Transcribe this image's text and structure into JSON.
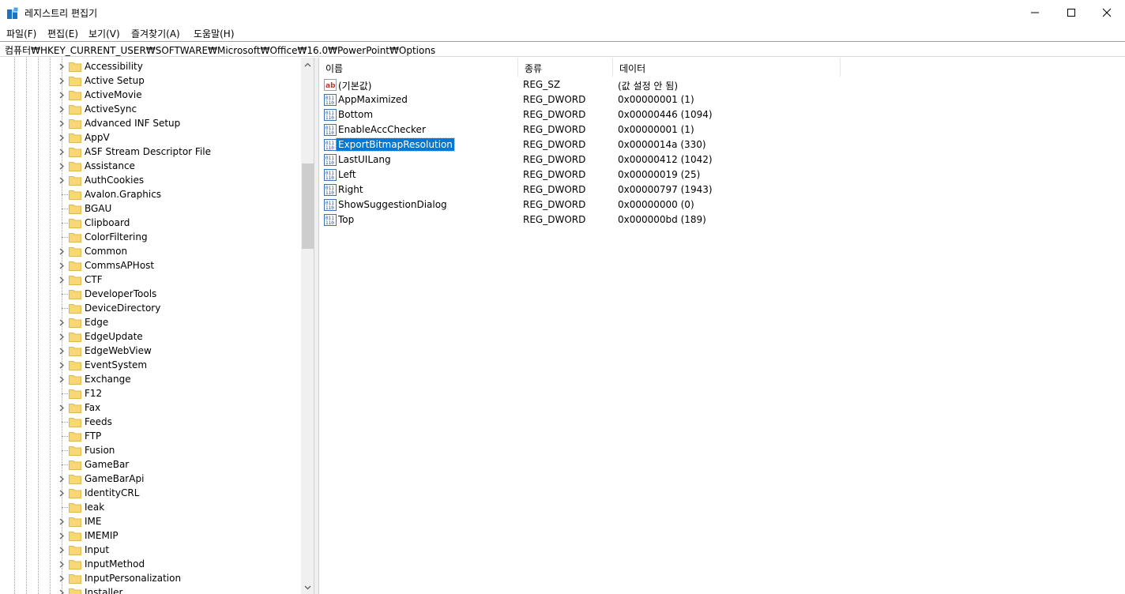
{
  "window": {
    "title": "레지스트리 편집기",
    "minimize_glyph": "—",
    "maximize_glyph": "☐",
    "close_glyph": "✕"
  },
  "menu": [
    "파일(F)",
    "편집(E)",
    "보기(V)",
    "즐겨찾기(A)",
    "도움말(H)"
  ],
  "address": "컴퓨터₩HKEY_CURRENT_USER₩SOFTWARE₩Microsoft₩Office₩16.0₩PowerPoint₩Options",
  "tree": {
    "items": [
      {
        "label": "Accessibility",
        "expandable": true
      },
      {
        "label": "Active Setup",
        "expandable": true
      },
      {
        "label": "ActiveMovie",
        "expandable": true
      },
      {
        "label": "ActiveSync",
        "expandable": true
      },
      {
        "label": "Advanced INF Setup",
        "expandable": true
      },
      {
        "label": "AppV",
        "expandable": true
      },
      {
        "label": "ASF Stream Descriptor File",
        "expandable": true
      },
      {
        "label": "Assistance",
        "expandable": true
      },
      {
        "label": "AuthCookies",
        "expandable": true
      },
      {
        "label": "Avalon.Graphics",
        "expandable": false
      },
      {
        "label": "BGAU",
        "expandable": false
      },
      {
        "label": "Clipboard",
        "expandable": false
      },
      {
        "label": "ColorFiltering",
        "expandable": false
      },
      {
        "label": "Common",
        "expandable": true
      },
      {
        "label": "CommsAPHost",
        "expandable": true
      },
      {
        "label": "CTF",
        "expandable": true
      },
      {
        "label": "DeveloperTools",
        "expandable": false
      },
      {
        "label": "DeviceDirectory",
        "expandable": false
      },
      {
        "label": "Edge",
        "expandable": true
      },
      {
        "label": "EdgeUpdate",
        "expandable": true
      },
      {
        "label": "EdgeWebView",
        "expandable": true
      },
      {
        "label": "EventSystem",
        "expandable": true
      },
      {
        "label": "Exchange",
        "expandable": true
      },
      {
        "label": "F12",
        "expandable": false
      },
      {
        "label": "Fax",
        "expandable": true
      },
      {
        "label": "Feeds",
        "expandable": false
      },
      {
        "label": "FTP",
        "expandable": false
      },
      {
        "label": "Fusion",
        "expandable": false
      },
      {
        "label": "GameBar",
        "expandable": false
      },
      {
        "label": "GameBarApi",
        "expandable": true
      },
      {
        "label": "IdentityCRL",
        "expandable": true
      },
      {
        "label": "Ieak",
        "expandable": false
      },
      {
        "label": "IME",
        "expandable": true
      },
      {
        "label": "IMEMIP",
        "expandable": true
      },
      {
        "label": "Input",
        "expandable": true
      },
      {
        "label": "InputMethod",
        "expandable": true
      },
      {
        "label": "InputPersonalization",
        "expandable": true
      },
      {
        "label": "Installer",
        "expandable": true
      }
    ]
  },
  "list": {
    "columns": [
      "이름",
      "종류",
      "데이터"
    ],
    "rows": [
      {
        "name": "(기본값)",
        "type": "REG_SZ",
        "data": "(값 설정 안 됨)",
        "icon": "string-value-icon",
        "selected": false
      },
      {
        "name": "AppMaximized",
        "type": "REG_DWORD",
        "data": "0x00000001 (1)",
        "icon": "binary-value-icon",
        "selected": false
      },
      {
        "name": "Bottom",
        "type": "REG_DWORD",
        "data": "0x00000446 (1094)",
        "icon": "binary-value-icon",
        "selected": false
      },
      {
        "name": "EnableAccChecker",
        "type": "REG_DWORD",
        "data": "0x00000001 (1)",
        "icon": "binary-value-icon",
        "selected": false
      },
      {
        "name": "ExportBitmapResolution",
        "type": "REG_DWORD",
        "data": "0x0000014a (330)",
        "icon": "binary-value-icon",
        "selected": true
      },
      {
        "name": "LastUILang",
        "type": "REG_DWORD",
        "data": "0x00000412 (1042)",
        "icon": "binary-value-icon",
        "selected": false
      },
      {
        "name": "Left",
        "type": "REG_DWORD",
        "data": "0x00000019 (25)",
        "icon": "binary-value-icon",
        "selected": false
      },
      {
        "name": "Right",
        "type": "REG_DWORD",
        "data": "0x00000797 (1943)",
        "icon": "binary-value-icon",
        "selected": false
      },
      {
        "name": "ShowSuggestionDialog",
        "type": "REG_DWORD",
        "data": "0x00000000 (0)",
        "icon": "binary-value-icon",
        "selected": false
      },
      {
        "name": "Top",
        "type": "REG_DWORD",
        "data": "0x000000bd (189)",
        "icon": "binary-value-icon",
        "selected": false
      }
    ]
  },
  "colors": {
    "selection": "#0078d7",
    "folder": "#f8d775",
    "folder_edge": "#e0b84a"
  }
}
